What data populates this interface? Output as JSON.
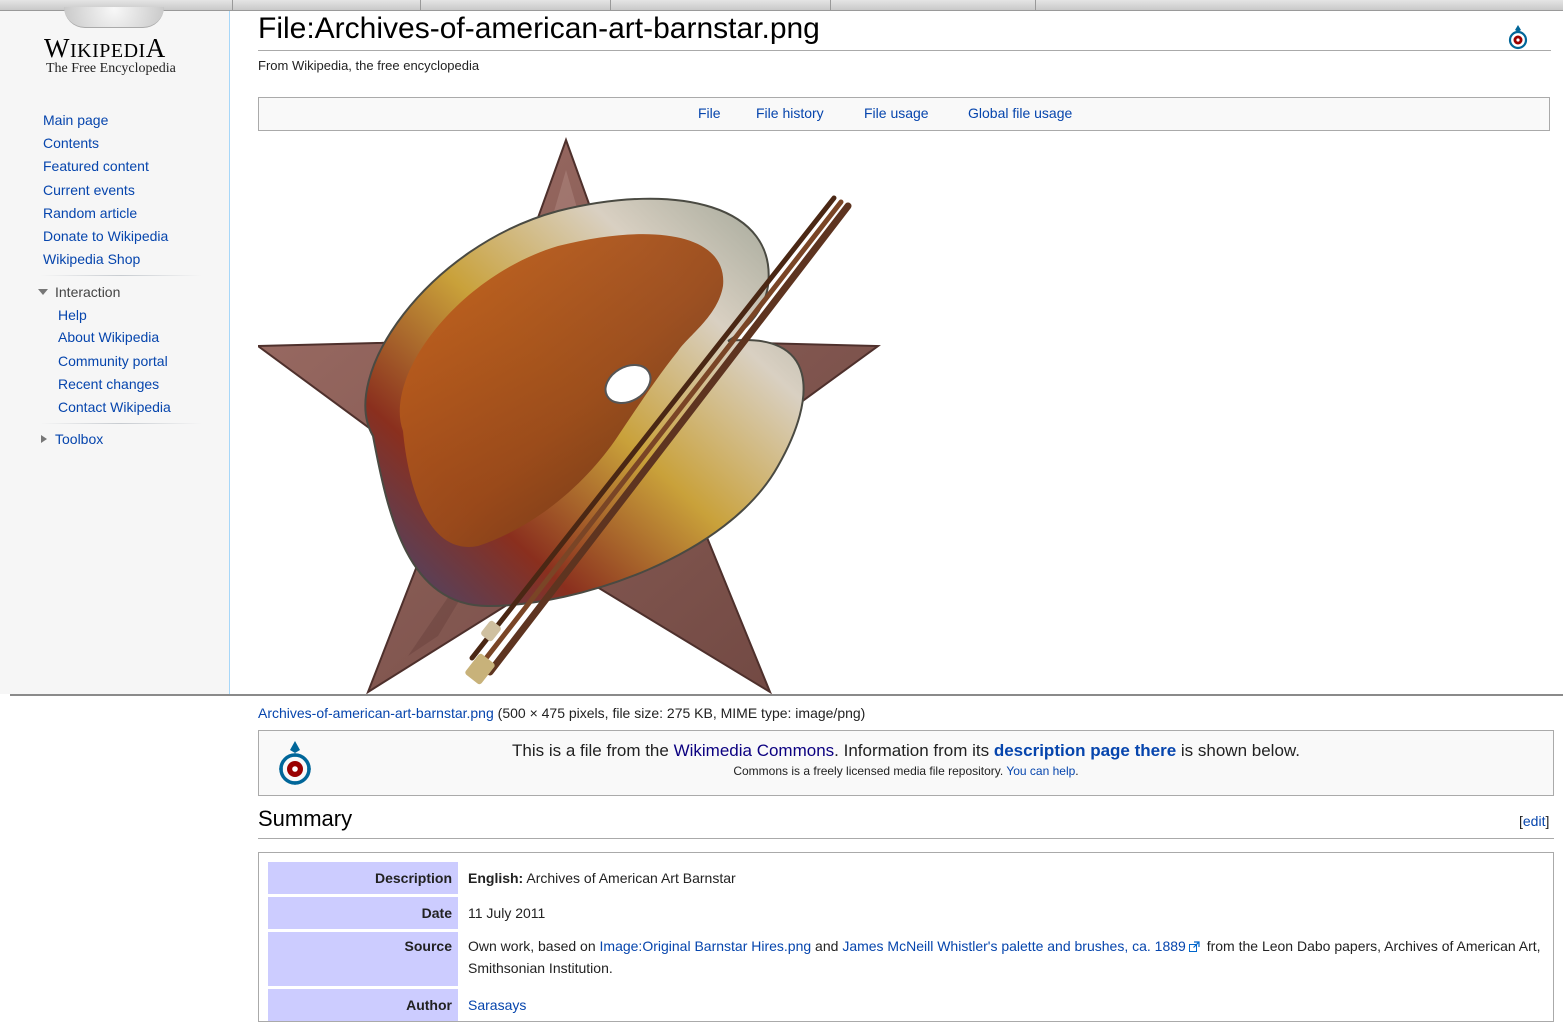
{
  "sidebar": {
    "logo": {
      "wordmark_first": "W",
      "wordmark_small": "IKIPEDI",
      "wordmark_last": "A",
      "tagline": "The Free Encyclopedia"
    },
    "navigation": [
      "Main page",
      "Contents",
      "Featured content",
      "Current events",
      "Random article",
      "Donate to Wikipedia",
      "Wikipedia Shop"
    ],
    "interaction": {
      "heading": "Interaction",
      "items": [
        "Help",
        "About Wikipedia",
        "Community portal",
        "Recent changes",
        "Contact Wikipedia"
      ]
    },
    "toolbox": {
      "heading": "Toolbox"
    }
  },
  "page": {
    "title": "File:Archives-of-american-art-barnstar.png",
    "site_sub": "From Wikipedia, the free encyclopedia",
    "file_toc": [
      "File",
      "File history",
      "File usage",
      "Global file usage"
    ],
    "file_info": {
      "link": "Archives-of-american-art-barnstar.png",
      "details": " (500 × 475 pixels, file size: 275 KB, MIME type: image/png)"
    },
    "commons_notice": {
      "text1": "This is a file from the ",
      "link1": "Wikimedia Commons",
      "text2": ". Information from its ",
      "link2": "description page there",
      "text3": " is shown below.",
      "sub_text": "Commons is a freely licensed media file repository. ",
      "sub_link": "You can help",
      "sub_end": "."
    },
    "summary": {
      "heading": "Summary",
      "edit_open": "[",
      "edit_label": "edit",
      "edit_close": "]",
      "rows": {
        "description": {
          "label": "Description",
          "lang": "English:",
          "value": " Archives of American Art Barnstar"
        },
        "date": {
          "label": "Date",
          "value": "11 July 2011"
        },
        "source": {
          "label": "Source",
          "text1": "Own work, based on ",
          "link1": "Image:Original Barnstar Hires.png",
          "text2": " and ",
          "link2": "James McNeill Whistler's palette and brushes, ca. 1889",
          "text3": " from the Leon Dabo papers, Archives of American Art, Smithsonian Institution."
        },
        "author": {
          "label": "Author",
          "value": "Sarasays"
        }
      }
    }
  },
  "colors": {
    "link": "#0645ad",
    "visited_link": "#0b0080",
    "sidebar_bg": "#f6f6f6",
    "table_header_bg": "#ccccff",
    "star": "#8a5a52"
  },
  "icons": [
    "globe-logo-icon",
    "commons-logo-icon",
    "disclosure-triangle-down-icon",
    "disclosure-triangle-right-icon",
    "external-link-icon"
  ]
}
